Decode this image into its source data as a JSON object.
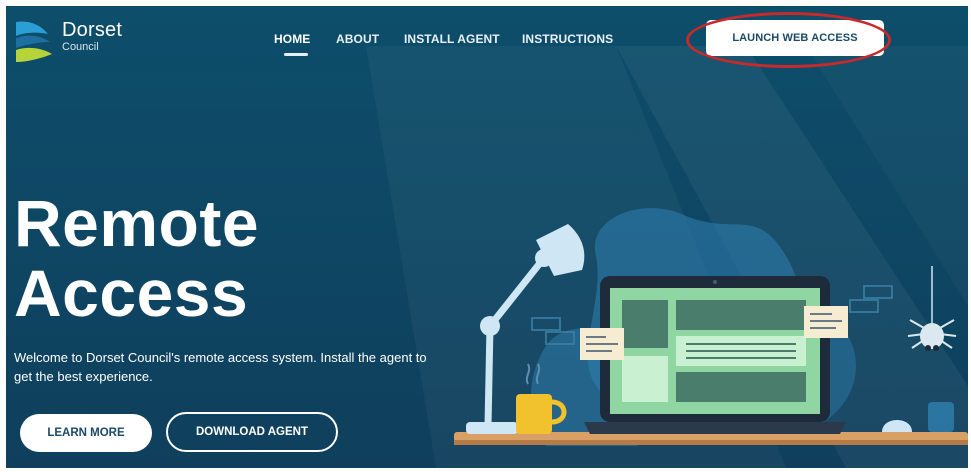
{
  "brand": {
    "name": "Dorset",
    "subname": "Council"
  },
  "nav": {
    "items": [
      {
        "label": "HOME",
        "active": true
      },
      {
        "label": "ABOUT",
        "active": false
      },
      {
        "label": "INSTALL AGENT",
        "active": false
      },
      {
        "label": "INSTRUCTIONS",
        "active": false
      }
    ],
    "launch_label": "LAUNCH WEB ACCESS"
  },
  "hero": {
    "title_line1": "Remote",
    "title_line2": "Access",
    "subtitle": "Welcome to Dorset Council's remote access system. Install the agent to get the best experience.",
    "learn_more_label": "LEARN MORE",
    "download_label": "DOWNLOAD AGENT"
  },
  "colors": {
    "background": "#0f4560",
    "accent_ring": "#c62a2a",
    "laptop_screen": "#8fd6a2",
    "lamp": "#cfe6f4",
    "mug": "#f2c12e",
    "desk": "#d9a066"
  },
  "icons": [
    "dorset-logo-icon",
    "desk-lamp-icon",
    "laptop-icon",
    "mug-icon",
    "spider-icon",
    "sticky-note-icon"
  ]
}
